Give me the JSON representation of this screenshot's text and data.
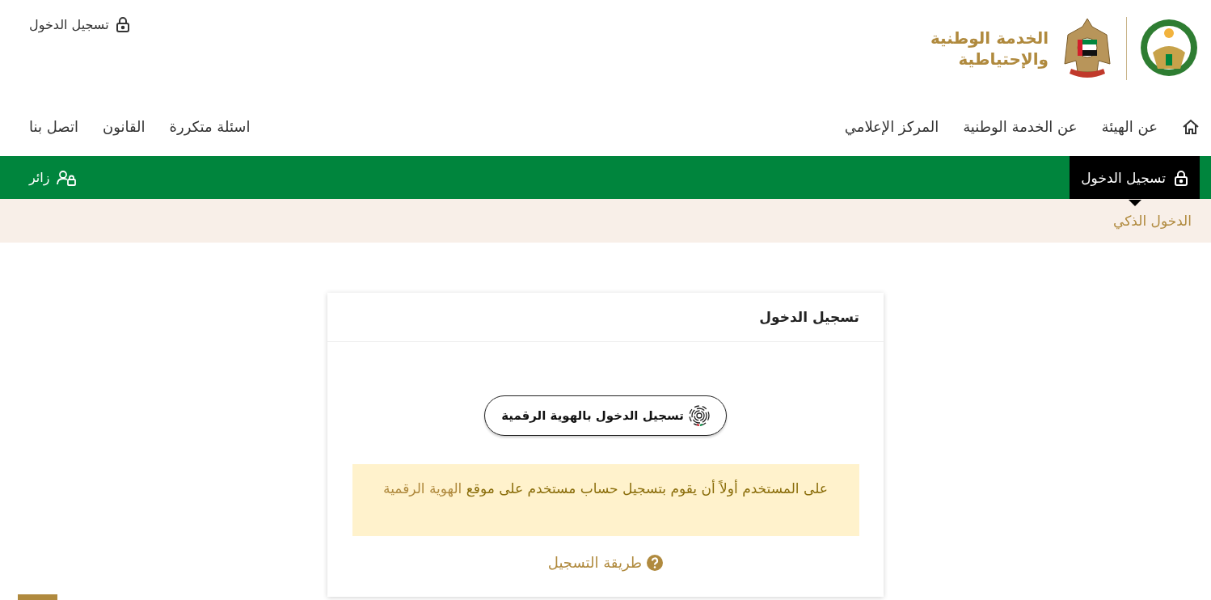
{
  "header": {
    "logo_text": [
      "الخدمة الوطنية",
      "والإحتياطية"
    ],
    "login_link": "تسجيل الدخول"
  },
  "nav": {
    "main": [
      {
        "label": "عن الهيئة"
      },
      {
        "label": "عن الخدمة الوطنية"
      },
      {
        "label": "المركز الإعلامي"
      }
    ],
    "secondary": [
      {
        "label": "اسئلة متكررة"
      },
      {
        "label": "القانون"
      },
      {
        "label": "اتصل بنا"
      }
    ]
  },
  "menu_bar": {
    "tabs": [
      {
        "label": "تسجيل الدخول",
        "selected": true
      }
    ],
    "visitor": "زائر"
  },
  "breadcrumb": "الدخول الذكي",
  "card": {
    "title": "تسجيل الدخول",
    "uae_pass_button": "تسجيل الدخول بالهوية الرقمية",
    "notice": {
      "text": "على المستخدم أولاً أن يقوم بتسجيل حساب مستخدم على موقع",
      "link": "الهوية الرقمية"
    },
    "help_link": "طريقة التسجيل"
  }
}
